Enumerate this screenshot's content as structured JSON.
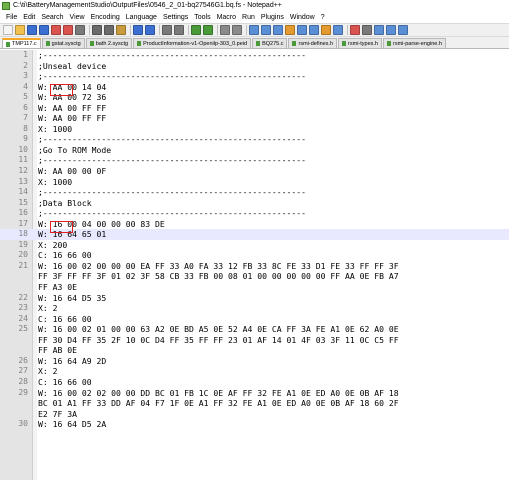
{
  "window": {
    "title": "C:\\ti\\BatteryManagementStudio\\OutputFiles\\0546_2_01-bq27546G1.bq.fs - Notepad++"
  },
  "menu": [
    "File",
    "Edit",
    "Search",
    "View",
    "Encoding",
    "Language",
    "Settings",
    "Tools",
    "Macro",
    "Run",
    "Plugins",
    "Window",
    "?"
  ],
  "toolbar": {
    "icons": [
      "new-file-icon",
      "open-file-icon",
      "save-icon",
      "save-all-icon",
      "close-icon",
      "close-all-icon",
      "print-icon",
      "cut-icon",
      "copy-icon",
      "paste-icon",
      "undo-icon",
      "redo-icon",
      "find-icon",
      "replace-icon",
      "zoom-in-icon",
      "zoom-out-icon",
      "sync-v-icon",
      "sync-h-icon",
      "word-wrap-icon",
      "all-chars-icon",
      "indent-guide-icon",
      "udl-icon",
      "doc-map-icon",
      "function-list-icon",
      "folder-workspace-icon",
      "monitoring-icon",
      "record-macro-icon",
      "stop-macro-icon",
      "play-macro-icon",
      "run-macro-icon",
      "save-macro-icon"
    ]
  },
  "tabs": [
    {
      "label": "TMP117.c"
    },
    {
      "label": "gstat.sysctg"
    },
    {
      "label": "bath 2.sysctg"
    },
    {
      "label": "ProductInformation-v1-Openilp-303_0.peid"
    },
    {
      "label": "BQ275.c"
    },
    {
      "label": "rsmi-defines.h"
    },
    {
      "label": "rsmi-types.h"
    },
    {
      "label": "rsmi-parse-engine.h"
    }
  ],
  "editor": {
    "lines": [
      {
        "num": "1",
        "text": ";------------------------------------------------------"
      },
      {
        "num": "2",
        "text": ";Unseal device"
      },
      {
        "num": "3",
        "text": ";------------------------------------------------------"
      },
      {
        "num": "4",
        "text": "W: AA 00 14 04"
      },
      {
        "num": "5",
        "text": "W: AA 00 72 36"
      },
      {
        "num": "6",
        "text": "W: AA 00 FF FF"
      },
      {
        "num": "7",
        "text": "W: AA 00 FF FF"
      },
      {
        "num": "8",
        "text": "X: 1000"
      },
      {
        "num": "9",
        "text": ";------------------------------------------------------"
      },
      {
        "num": "10",
        "text": ";Go To ROM Mode"
      },
      {
        "num": "11",
        "text": ";------------------------------------------------------"
      },
      {
        "num": "12",
        "text": "W: AA 00 00 0F"
      },
      {
        "num": "13",
        "text": "X: 1000"
      },
      {
        "num": "14",
        "text": ";------------------------------------------------------"
      },
      {
        "num": "15",
        "text": ";Data Block"
      },
      {
        "num": "16",
        "text": ";------------------------------------------------------"
      },
      {
        "num": "17",
        "text": "W: 16 00 04 00 00 00 83 DE"
      },
      {
        "num": "18",
        "text": "W: 16 64 65 01"
      },
      {
        "num": "19",
        "text": "X: 200"
      },
      {
        "num": "20",
        "text": "C: 16 66 00"
      },
      {
        "num": "21",
        "text": "W: 16 00 02 00 00 00 EA FF 33 A0 FA 33 12 FB 33 8C FE 33 D1 FE 33 FF FF 3F"
      },
      {
        "num": "",
        "text": "FF 3F FF FF 3F 01 02 3F 58 CB 33 FB 00 08 01 00 00 00 00 00 FF AA 0E FB A7"
      },
      {
        "num": "",
        "text": "FF A3 0E"
      },
      {
        "num": "22",
        "text": "W: 16 64 D5 35"
      },
      {
        "num": "23",
        "text": "X: 2"
      },
      {
        "num": "24",
        "text": "C: 16 66 00"
      },
      {
        "num": "25",
        "text": "W: 16 00 02 01 00 00 63 A2 0E BD A5 0E 52 A4 0E CA FF 3A FE A1 0E 62 A0 0E"
      },
      {
        "num": "",
        "text": "FF 30 D4 FF 35 2F 10 0C D4 FF 35 FF FF 23 01 AF 14 01 4F 03 3F 11 0C C5 FF"
      },
      {
        "num": "",
        "text": "FF AB 0E"
      },
      {
        "num": "26",
        "text": "W: 16 64 A9 2D"
      },
      {
        "num": "27",
        "text": "X: 2"
      },
      {
        "num": "28",
        "text": "C: 16 66 00"
      },
      {
        "num": "29",
        "text": "W: 16 00 02 02 00 00 DD BC 01 FB 1C 0E AF FF 32 FE A1 0E ED A0 0E 0B AF 18"
      },
      {
        "num": "",
        "text": "BC 01 A1 FF 33 DD AF 04 F7 1F 0E A1 FF 32 FE A1 0E ED A0 0E 0B AF 18 60 2F"
      },
      {
        "num": "",
        "text": "E2 7F 3A"
      },
      {
        "num": "30",
        "text": "W: 16 64 D5 2A"
      }
    ],
    "highlighted_line": "18"
  }
}
